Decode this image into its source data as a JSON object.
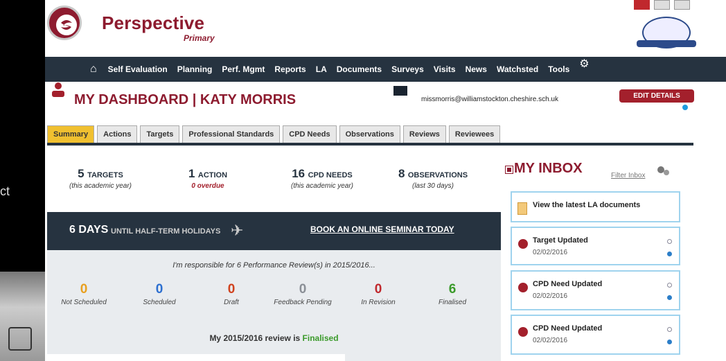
{
  "brand": {
    "name": "Perspective",
    "subtitle": "Primary"
  },
  "nav": {
    "items": [
      "Self Evaluation",
      "Planning",
      "Perf. Mgmt",
      "Reports",
      "LA",
      "Documents",
      "Surveys",
      "Visits",
      "News",
      "Watchsted",
      "Tools"
    ]
  },
  "dashboard": {
    "title": "MY DASHBOARD | KATY MORRIS",
    "email": "missmorris@williamstockton.cheshire.sch.uk",
    "edit_label": "EDIT DETAILS"
  },
  "tabs": [
    "Summary",
    "Actions",
    "Targets",
    "Professional Standards",
    "CPD Needs",
    "Observations",
    "Reviews",
    "Reviewees"
  ],
  "active_tab": "Summary",
  "stats": [
    {
      "num": "5",
      "label": "TARGETS",
      "sub": "(this academic year)"
    },
    {
      "num": "1",
      "label": "ACTION",
      "sub": "0 overdue"
    },
    {
      "num": "16",
      "label": "CPD NEEDS",
      "sub": "(this academic year)"
    },
    {
      "num": "8",
      "label": "OBSERVATIONS",
      "sub": "(last 30 days)"
    }
  ],
  "banner": {
    "days": "6 DAYS",
    "until": "UNTIL HALF-TERM HOLIDAYS",
    "seminar": "BOOK AN ONLINE SEMINAR TODAY"
  },
  "reviews": {
    "responsible": "I'm responsible for 6 Performance Review(s) in 2015/2016...",
    "items": [
      {
        "n": "0",
        "label": "Not Scheduled",
        "color": "#e8a020"
      },
      {
        "n": "0",
        "label": "Scheduled",
        "color": "#2c6fd0"
      },
      {
        "n": "0",
        "label": "Draft",
        "color": "#d0421e"
      },
      {
        "n": "0",
        "label": "Feedback Pending",
        "color": "#8a8f96"
      },
      {
        "n": "0",
        "label": "In Revision",
        "color": "#c0282d"
      },
      {
        "n": "6",
        "label": "Finalised",
        "color": "#3a9a2a"
      }
    ],
    "my_review_prefix": "My 2015/2016 review is ",
    "my_review_status": "Finalised"
  },
  "inbox": {
    "title": "MY INBOX",
    "filter": "Filter Inbox",
    "cards": [
      {
        "title": "View the latest LA documents",
        "date": ""
      },
      {
        "title": "Target Updated",
        "date": "02/02/2016"
      },
      {
        "title": "CPD Need Updated",
        "date": "02/02/2016"
      },
      {
        "title": "CPD Need Updated",
        "date": "02/02/2016"
      }
    ]
  },
  "fragment_text": "ct"
}
